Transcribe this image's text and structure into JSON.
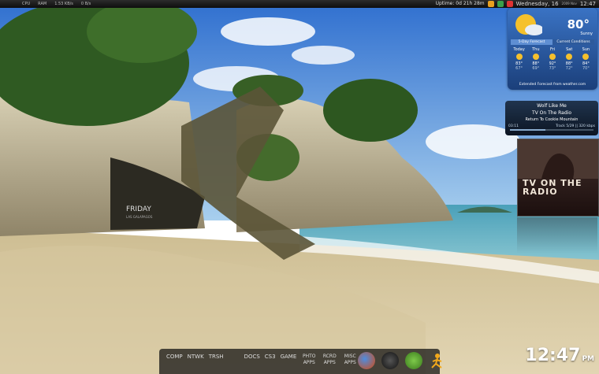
{
  "topbar": {
    "stats": [
      "CPU",
      "RAM",
      "1.53 KB/s",
      "0 B/s"
    ],
    "uptime": "Uptime: 0d 21h 28m",
    "date": "Wednesday, 16",
    "date_sub": "2009 Nov",
    "clock": "12:47"
  },
  "weather": {
    "temp": "80°",
    "condition": "Sunny",
    "tabs": [
      "5-Day Forecast",
      "Current Conditions"
    ],
    "days": [
      {
        "name": "Today",
        "hi": "83°",
        "lo": "67°"
      },
      {
        "name": "Thu",
        "hi": "88°",
        "lo": "69°"
      },
      {
        "name": "Fri",
        "hi": "92°",
        "lo": "73°"
      },
      {
        "name": "Sat",
        "hi": "88°",
        "lo": "72°"
      },
      {
        "name": "Sun",
        "hi": "84°",
        "lo": "70°"
      }
    ],
    "extended": "Extended Forecast from weather.com"
  },
  "music": {
    "title": "Wolf Like Me",
    "artist": "TV On The Radio",
    "album": "Return To Cookie Mountain",
    "elapsed": "03:11",
    "track": "Track 5/29 || 320 kbps",
    "progress": 0.42,
    "cover_text": "TV ON THE RADIO"
  },
  "desktop": {
    "friday_title": "FRIDAY",
    "friday_sub": "LAS GALAPAGOS"
  },
  "dock": {
    "labels": [
      "COMP",
      "NTWK",
      "TRSH",
      "DOCS",
      "CS3",
      "GAME",
      "PHTO APPS",
      "RCRD APPS",
      "MISC APPS"
    ],
    "apps": [
      "firefox-icon",
      "media-player-icon",
      "pidgin-icon",
      "runner-icon"
    ]
  },
  "clock": {
    "time": "12:47",
    "ampm": "PM"
  }
}
